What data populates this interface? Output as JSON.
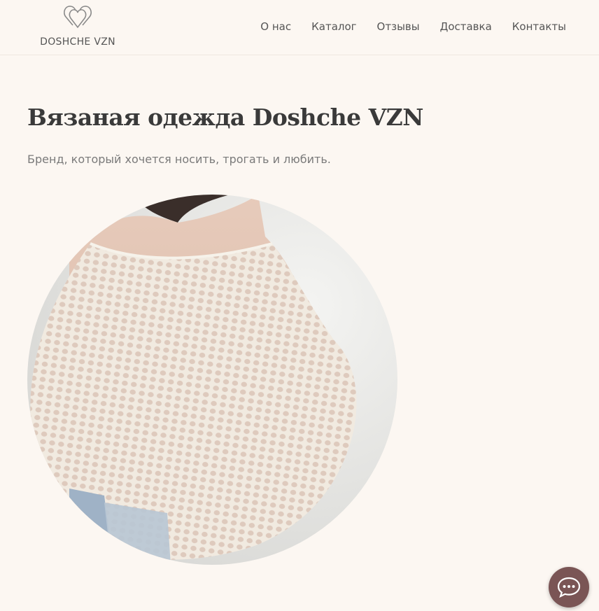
{
  "brand": {
    "name": "DOSHCHE VZN",
    "logo_icon": "intertwined-hearts-icon"
  },
  "nav": {
    "items": [
      {
        "label": "О нас"
      },
      {
        "label": "Каталог"
      },
      {
        "label": "Отзывы"
      },
      {
        "label": "Доставка"
      },
      {
        "label": "Контакты"
      }
    ]
  },
  "hero": {
    "title": "Вязаная одежда Doshche VZN",
    "subtitle": "Бренд, который хочется носить, трогать и любить.",
    "image_icon": "knit-sweater-photo"
  },
  "chat": {
    "icon": "chat-bubble-icon",
    "color": "#7a5555"
  },
  "colors": {
    "background": "#fcf7f2",
    "accent": "#7a5555"
  }
}
